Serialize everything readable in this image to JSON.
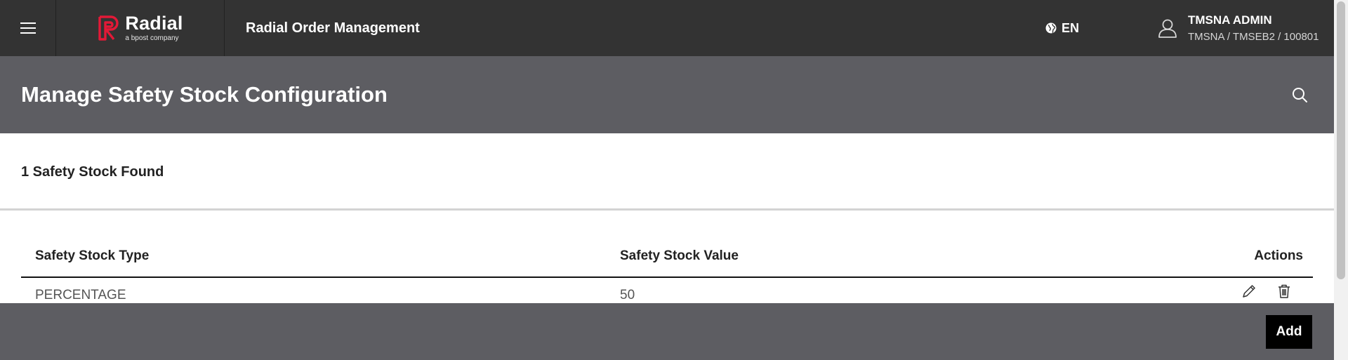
{
  "header": {
    "menu_icon": "hamburger-menu-icon",
    "brand": {
      "name": "Radial",
      "tagline": "a bpost company",
      "color": "#e31937"
    },
    "app_title": "Radial Order Management",
    "language": {
      "icon": "globe-icon",
      "code": "EN"
    },
    "user": {
      "icon": "user-icon",
      "name": "TMSNA ADMIN",
      "org": "TMSNA / TMSEB2 / 100801"
    }
  },
  "page": {
    "title": "Manage Safety Stock Configuration",
    "search_icon": "search-icon"
  },
  "results": {
    "count_text": "1 Safety Stock Found"
  },
  "table": {
    "columns": [
      "Safety Stock Type",
      "Safety Stock Value",
      "Actions"
    ],
    "rows": [
      {
        "type": "PERCENTAGE",
        "value": "50",
        "actions": [
          "edit-icon",
          "delete-icon"
        ]
      }
    ]
  },
  "footer": {
    "add_label": "Add"
  },
  "colors": {
    "topbar": "#333333",
    "titlebar": "#5d5d62",
    "accent": "#e31937",
    "button": "#000000"
  }
}
